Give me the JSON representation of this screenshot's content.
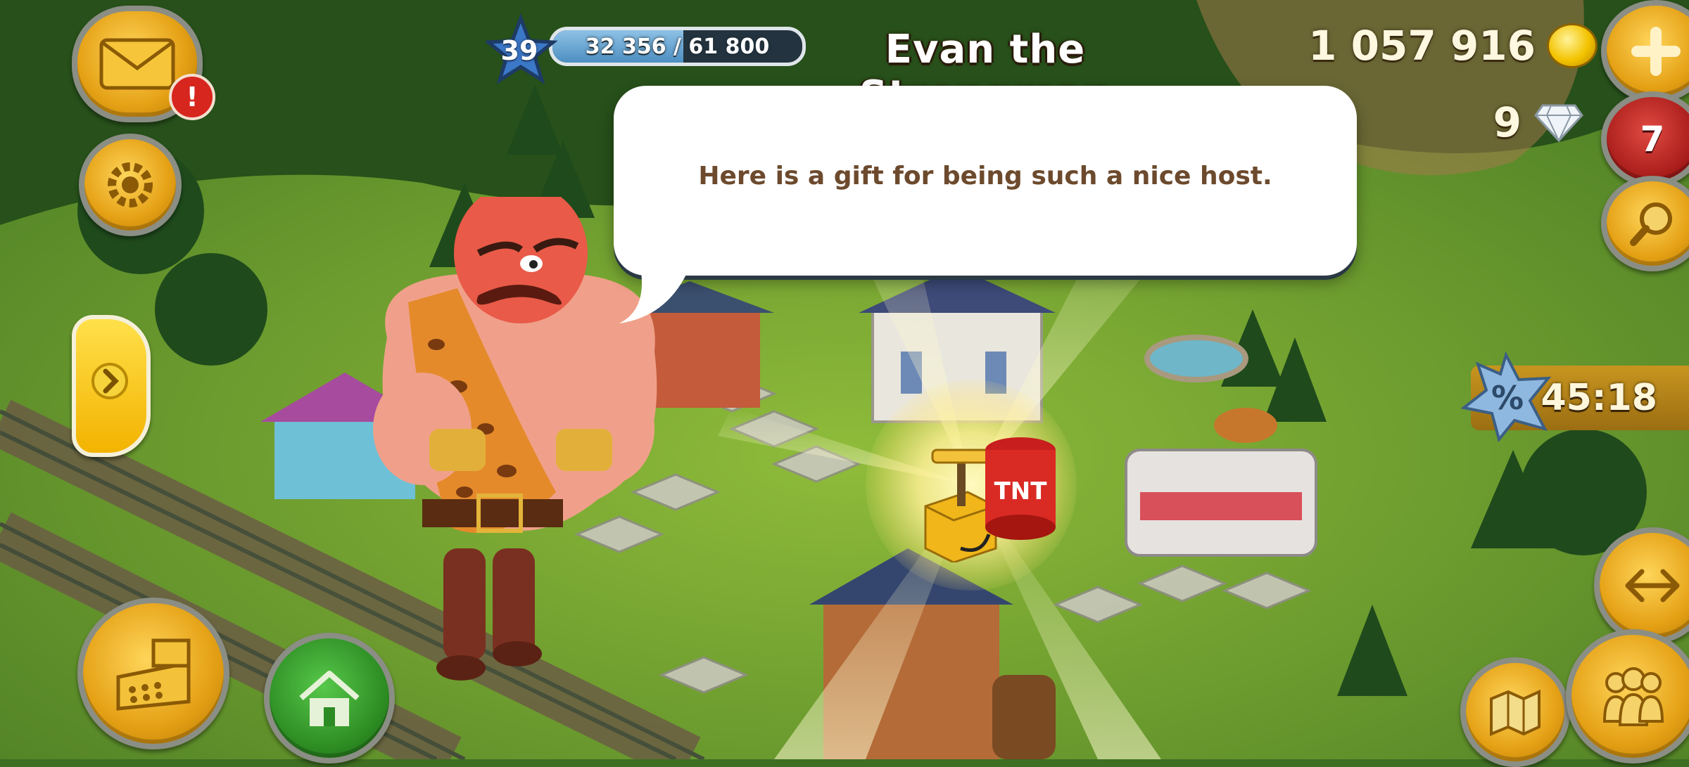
{
  "hud": {
    "level": "39",
    "xp_text": "32 356 / 61 800",
    "xp_progress": 0.5236,
    "coins": "1 057 916",
    "gems": "9",
    "notification_count": "7",
    "mail_alert": "!",
    "timer": "45:18"
  },
  "dialog": {
    "speaker": "Evan the Strongman",
    "message": "Here is a gift for being such a nice host.",
    "gift_label": "TNT"
  },
  "icons": {
    "mail": "envelope-icon",
    "settings": "gear-icon",
    "expand": "chevron-right-icon",
    "add": "plus-icon",
    "search": "magnifier-icon",
    "shop": "cash-register-icon",
    "home": "house-icon",
    "sale": "percent-badge-icon",
    "zoom": "expand-arrows-icon",
    "map": "map-icon",
    "friends": "people-icon"
  },
  "colors": {
    "accent": "#f3b300",
    "dialog_text": "#6d4a2d",
    "xp_bar": "#4d8fc2"
  }
}
